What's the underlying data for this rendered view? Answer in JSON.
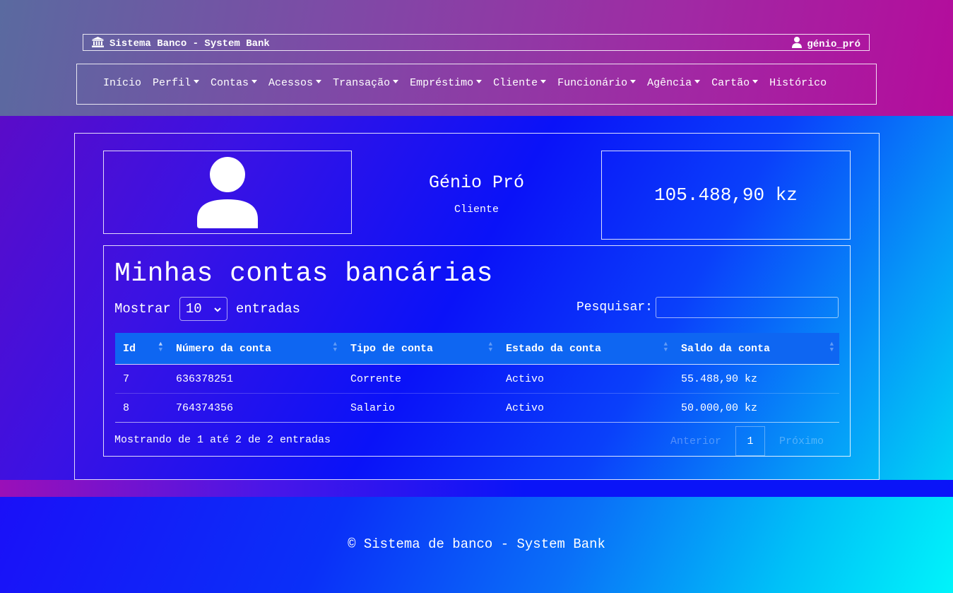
{
  "header": {
    "brand": "Sistema Banco - System Bank",
    "brand_icon": "bank-icon",
    "user": "génio_pró",
    "user_icon": "user-icon"
  },
  "nav": {
    "items": [
      {
        "label": "Início"
      },
      {
        "label": "Perfil",
        "dropdown": true
      },
      {
        "label": "Contas",
        "dropdown": true
      },
      {
        "label": "Acessos",
        "dropdown": true
      },
      {
        "label": "Transação",
        "dropdown": true
      },
      {
        "label": "Empréstimo",
        "dropdown": true
      },
      {
        "label": "Cliente",
        "dropdown": true
      },
      {
        "label": "Funcionário",
        "dropdown": true
      },
      {
        "label": "Agência",
        "dropdown": true
      },
      {
        "label": "Cartão",
        "dropdown": true
      },
      {
        "label": "Histórico"
      }
    ]
  },
  "profile": {
    "name": "Génio Pró",
    "role": "Cliente",
    "balance": "105.488,90 kz",
    "avatar_icon": "user-avatar-icon"
  },
  "accounts": {
    "title": "Minhas contas bancárias",
    "length_prefix": "Mostrar",
    "length_value": "10",
    "length_suffix": "entradas",
    "search_label": "Pesquisar:",
    "search_value": "",
    "columns": [
      "Id",
      "Número da conta",
      "Tipo de conta",
      "Estado da conta",
      "Saldo da conta"
    ],
    "rows": [
      [
        "7",
        "636378251",
        "Corrente",
        "Activo",
        "55.488,90 kz"
      ],
      [
        "8",
        "764374356",
        "Salario",
        "Activo",
        "50.000,00 kz"
      ]
    ],
    "info": "Mostrando de 1 até 2 de 2 entradas",
    "pagination": {
      "previous": "Anterior",
      "current": "1",
      "next": "Próximo"
    }
  },
  "footer": {
    "copyright": "© Sistema de banco - System Bank"
  }
}
